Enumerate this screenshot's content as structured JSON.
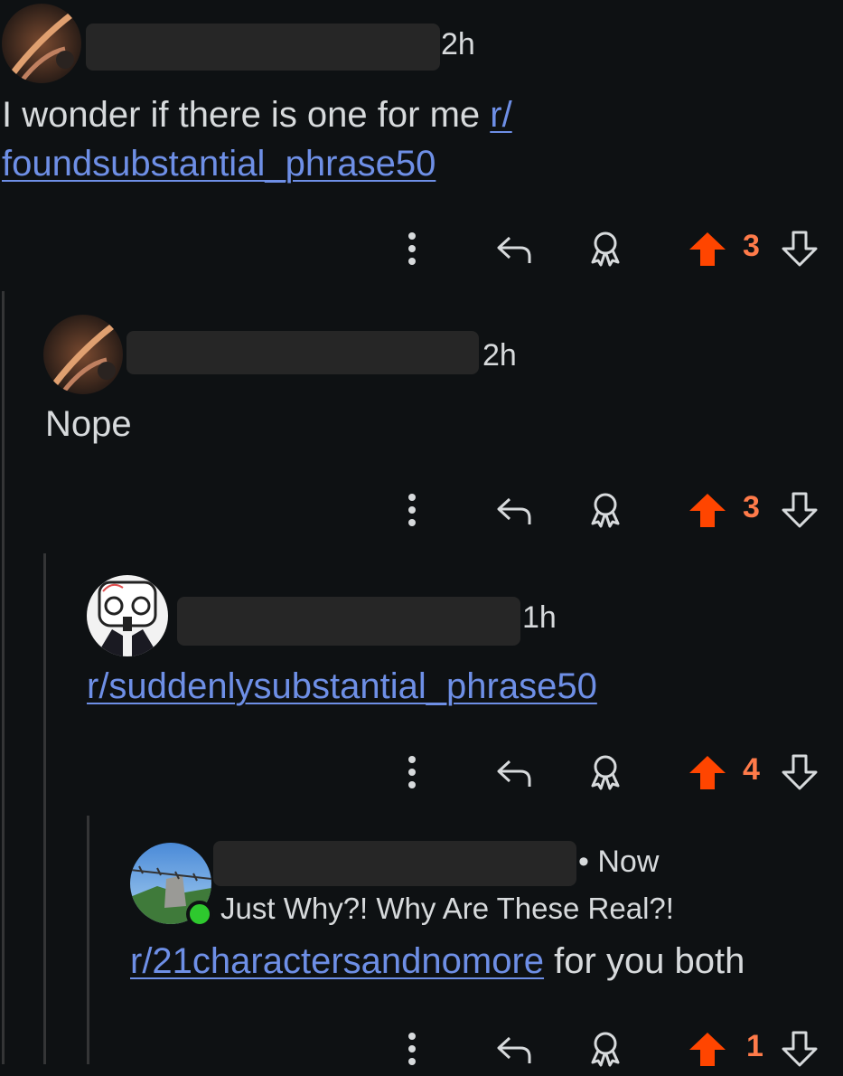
{
  "comments": [
    {
      "time": "2h",
      "text_before": "I wonder if there is one for me ",
      "link_line1": "r/",
      "link_line2": "foundsubstantial_phrase50",
      "score": "3"
    },
    {
      "time": "2h",
      "text": "Nope",
      "score": "3"
    },
    {
      "time": "1h",
      "link": "r/suddenlysubstantial_phrase50",
      "score": "4"
    },
    {
      "time": "• Now",
      "flair": "Just Why?! Why Are These Real?!",
      "link": "r/21charactersandnomore",
      "text_after": " for you both",
      "score": "1"
    }
  ],
  "colors": {
    "background": "#0e1113",
    "upvote_active": "#ff4500",
    "score": "#ff7b4a",
    "link": "#6e8fe6",
    "online": "#2ec92e"
  },
  "icons": [
    "more-options-icon",
    "reply-icon",
    "award-icon",
    "upvote-icon",
    "downvote-icon"
  ]
}
